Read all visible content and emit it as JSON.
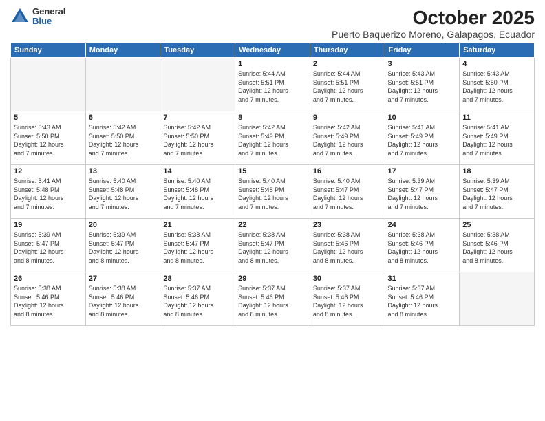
{
  "logo": {
    "general": "General",
    "blue": "Blue"
  },
  "title": "October 2025",
  "location": "Puerto Baquerizo Moreno, Galapagos, Ecuador",
  "days_of_week": [
    "Sunday",
    "Monday",
    "Tuesday",
    "Wednesday",
    "Thursday",
    "Friday",
    "Saturday"
  ],
  "weeks": [
    [
      {
        "day": "",
        "info": ""
      },
      {
        "day": "",
        "info": ""
      },
      {
        "day": "",
        "info": ""
      },
      {
        "day": "1",
        "info": "Sunrise: 5:44 AM\nSunset: 5:51 PM\nDaylight: 12 hours\nand 7 minutes."
      },
      {
        "day": "2",
        "info": "Sunrise: 5:44 AM\nSunset: 5:51 PM\nDaylight: 12 hours\nand 7 minutes."
      },
      {
        "day": "3",
        "info": "Sunrise: 5:43 AM\nSunset: 5:51 PM\nDaylight: 12 hours\nand 7 minutes."
      },
      {
        "day": "4",
        "info": "Sunrise: 5:43 AM\nSunset: 5:50 PM\nDaylight: 12 hours\nand 7 minutes."
      }
    ],
    [
      {
        "day": "5",
        "info": "Sunrise: 5:43 AM\nSunset: 5:50 PM\nDaylight: 12 hours\nand 7 minutes."
      },
      {
        "day": "6",
        "info": "Sunrise: 5:42 AM\nSunset: 5:50 PM\nDaylight: 12 hours\nand 7 minutes."
      },
      {
        "day": "7",
        "info": "Sunrise: 5:42 AM\nSunset: 5:50 PM\nDaylight: 12 hours\nand 7 minutes."
      },
      {
        "day": "8",
        "info": "Sunrise: 5:42 AM\nSunset: 5:49 PM\nDaylight: 12 hours\nand 7 minutes."
      },
      {
        "day": "9",
        "info": "Sunrise: 5:42 AM\nSunset: 5:49 PM\nDaylight: 12 hours\nand 7 minutes."
      },
      {
        "day": "10",
        "info": "Sunrise: 5:41 AM\nSunset: 5:49 PM\nDaylight: 12 hours\nand 7 minutes."
      },
      {
        "day": "11",
        "info": "Sunrise: 5:41 AM\nSunset: 5:49 PM\nDaylight: 12 hours\nand 7 minutes."
      }
    ],
    [
      {
        "day": "12",
        "info": "Sunrise: 5:41 AM\nSunset: 5:48 PM\nDaylight: 12 hours\nand 7 minutes."
      },
      {
        "day": "13",
        "info": "Sunrise: 5:40 AM\nSunset: 5:48 PM\nDaylight: 12 hours\nand 7 minutes."
      },
      {
        "day": "14",
        "info": "Sunrise: 5:40 AM\nSunset: 5:48 PM\nDaylight: 12 hours\nand 7 minutes."
      },
      {
        "day": "15",
        "info": "Sunrise: 5:40 AM\nSunset: 5:48 PM\nDaylight: 12 hours\nand 7 minutes."
      },
      {
        "day": "16",
        "info": "Sunrise: 5:40 AM\nSunset: 5:47 PM\nDaylight: 12 hours\nand 7 minutes."
      },
      {
        "day": "17",
        "info": "Sunrise: 5:39 AM\nSunset: 5:47 PM\nDaylight: 12 hours\nand 7 minutes."
      },
      {
        "day": "18",
        "info": "Sunrise: 5:39 AM\nSunset: 5:47 PM\nDaylight: 12 hours\nand 7 minutes."
      }
    ],
    [
      {
        "day": "19",
        "info": "Sunrise: 5:39 AM\nSunset: 5:47 PM\nDaylight: 12 hours\nand 8 minutes."
      },
      {
        "day": "20",
        "info": "Sunrise: 5:39 AM\nSunset: 5:47 PM\nDaylight: 12 hours\nand 8 minutes."
      },
      {
        "day": "21",
        "info": "Sunrise: 5:38 AM\nSunset: 5:47 PM\nDaylight: 12 hours\nand 8 minutes."
      },
      {
        "day": "22",
        "info": "Sunrise: 5:38 AM\nSunset: 5:47 PM\nDaylight: 12 hours\nand 8 minutes."
      },
      {
        "day": "23",
        "info": "Sunrise: 5:38 AM\nSunset: 5:46 PM\nDaylight: 12 hours\nand 8 minutes."
      },
      {
        "day": "24",
        "info": "Sunrise: 5:38 AM\nSunset: 5:46 PM\nDaylight: 12 hours\nand 8 minutes."
      },
      {
        "day": "25",
        "info": "Sunrise: 5:38 AM\nSunset: 5:46 PM\nDaylight: 12 hours\nand 8 minutes."
      }
    ],
    [
      {
        "day": "26",
        "info": "Sunrise: 5:38 AM\nSunset: 5:46 PM\nDaylight: 12 hours\nand 8 minutes."
      },
      {
        "day": "27",
        "info": "Sunrise: 5:38 AM\nSunset: 5:46 PM\nDaylight: 12 hours\nand 8 minutes."
      },
      {
        "day": "28",
        "info": "Sunrise: 5:37 AM\nSunset: 5:46 PM\nDaylight: 12 hours\nand 8 minutes."
      },
      {
        "day": "29",
        "info": "Sunrise: 5:37 AM\nSunset: 5:46 PM\nDaylight: 12 hours\nand 8 minutes."
      },
      {
        "day": "30",
        "info": "Sunrise: 5:37 AM\nSunset: 5:46 PM\nDaylight: 12 hours\nand 8 minutes."
      },
      {
        "day": "31",
        "info": "Sunrise: 5:37 AM\nSunset: 5:46 PM\nDaylight: 12 hours\nand 8 minutes."
      },
      {
        "day": "",
        "info": ""
      }
    ]
  ]
}
